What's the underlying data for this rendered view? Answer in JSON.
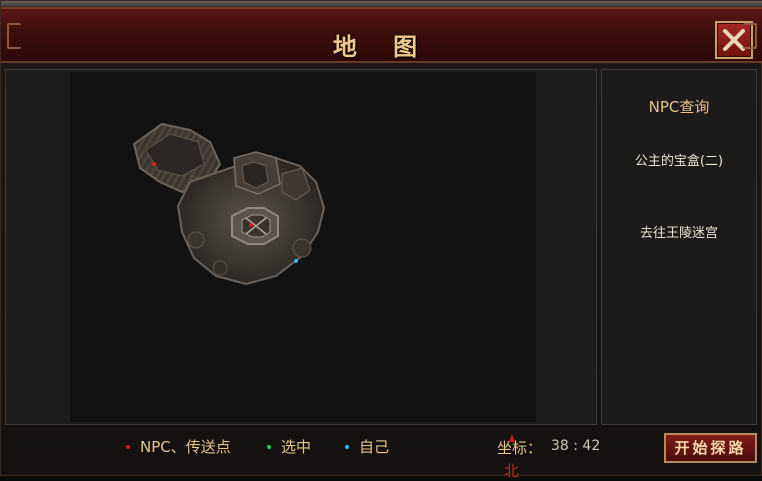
{
  "window": {
    "title": "地 图",
    "close_icon": "close-x-icon"
  },
  "map": {
    "north_label": "北",
    "markers": [
      {
        "type": "npc",
        "color": "#d81b1b"
      },
      {
        "type": "npc",
        "color": "#d81b1b"
      },
      {
        "type": "self",
        "color": "#2fb7e6"
      }
    ]
  },
  "side_panel": {
    "title": "NPC查询",
    "items": [
      {
        "label": "公主的宝盒(二)"
      },
      {
        "label": "去往王陵迷宫"
      }
    ]
  },
  "legend": [
    {
      "label": "NPC、传送点",
      "color": "#d81b1b"
    },
    {
      "label": "选中",
      "color": "#1fcf5a"
    },
    {
      "label": "自己",
      "color": "#2fb7e6"
    }
  ],
  "coords": {
    "label": "坐标：",
    "value": "38 : 42"
  },
  "start_button": {
    "label": "开始探路"
  }
}
